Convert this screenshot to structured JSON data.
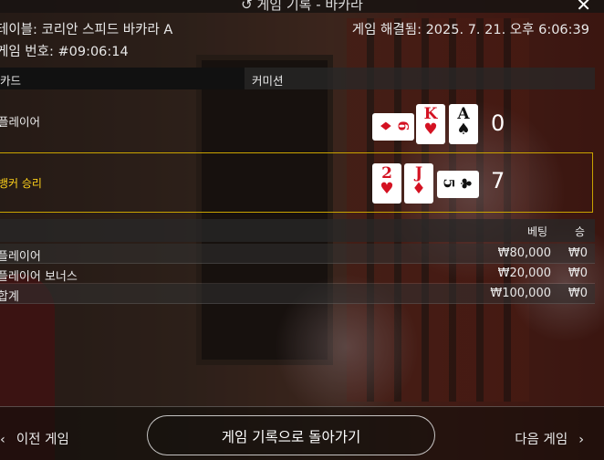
{
  "header": {
    "title": "게임 기록 - 바카라",
    "table": "테이블: 코리안 스피드 바카라 A",
    "round": "게임 번호: #09:06:14",
    "resolved": "게임 해결됨: 2025. 7. 21. 오후 6:06:39"
  },
  "columns": {
    "mode": "카드",
    "commission": "커미션"
  },
  "player": {
    "label": "플레이어",
    "score": "0",
    "cards": [
      {
        "rank": "6",
        "suit": "♦",
        "color": "#d41222",
        "orientation": "sideways"
      },
      {
        "rank": "K",
        "suit": "♥",
        "color": "#d41222",
        "orientation": "upright"
      },
      {
        "rank": "A",
        "suit": "♠",
        "color": "#111111",
        "orientation": "upright"
      }
    ]
  },
  "banker": {
    "label": "뱅커 승리",
    "score": "7",
    "cards": [
      {
        "rank": "2",
        "suit": "♥",
        "color": "#d41222",
        "orientation": "upright"
      },
      {
        "rank": "J",
        "suit": "♦",
        "color": "#d41222",
        "orientation": "upright"
      },
      {
        "rank": "5",
        "suit": "♣",
        "color": "#111111",
        "orientation": "sideways"
      }
    ]
  },
  "bets": {
    "col_bet": "베팅",
    "col_win": "승",
    "rows": [
      {
        "name": "플레이어",
        "bet": "₩80,000",
        "win": "₩0"
      },
      {
        "name": "플레이어 보너스",
        "bet": "₩20,000",
        "win": "₩0"
      },
      {
        "name": "합계",
        "bet": "₩100,000",
        "win": "₩0"
      }
    ]
  },
  "footer": {
    "prev": "이전 게임",
    "back": "게임 기록으로 돌아가기",
    "next": "다음 게임"
  },
  "icons": {
    "close": "close-icon",
    "title": "history-icon",
    "prev": "chevron-left-icon",
    "next": "chevron-right-icon"
  },
  "colors": {
    "highlight": "#c9a300",
    "banker_label": "#ffd21a",
    "red_suit": "#d41222"
  }
}
